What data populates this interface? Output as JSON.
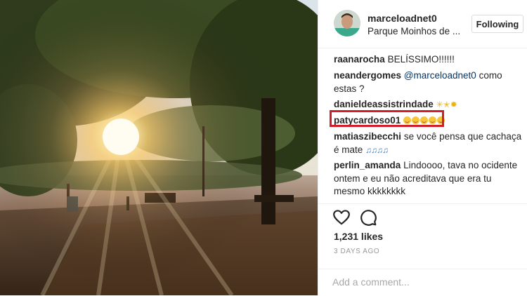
{
  "post": {
    "username": "marceloadnet0",
    "location": "Parque Moinhos de ...",
    "follow_label": "Following"
  },
  "comments": [
    {
      "user": "raanarocha",
      "text": "BELÍSSIMO!!!!!!"
    },
    {
      "user": "neandergomes",
      "mention": "@marceloadnet0",
      "text": "como estas ?"
    },
    {
      "user": "danieldeassistrindade",
      "text": ""
    },
    {
      "user": "patycardoso01",
      "text": ""
    },
    {
      "user": "matiaszibecchi",
      "text": "se você pensa que cachaça é mate"
    },
    {
      "user": "perlin_amanda",
      "text": "Lindoooo, tava no ocidente ontem e eu não acreditava que era tu mesmo kkkkkkkk"
    }
  ],
  "stats": {
    "likes": "1,231 likes",
    "posted": "3 DAYS AGO"
  },
  "add_comment": {
    "placeholder": "Add a comment..."
  },
  "icons": {
    "like": "heart-icon",
    "comment": "comment-bubble-icon",
    "avatar": "user-avatar",
    "emoji": "smiling-face-emoji",
    "music": "musical-notes-emoji",
    "sparkles": "sparkles-emoji"
  },
  "colors": {
    "highlight": "#d01f2a",
    "mention": "#003569",
    "timestamp": "#999999"
  }
}
